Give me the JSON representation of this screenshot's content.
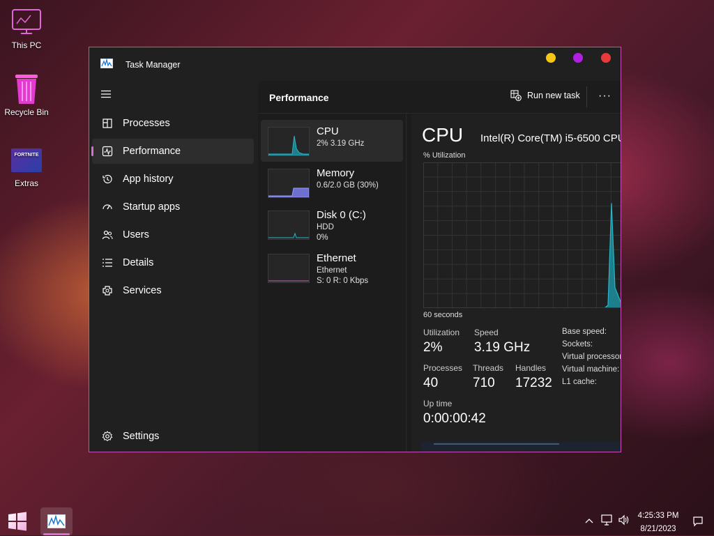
{
  "desktop": {
    "icons": [
      {
        "label": "This PC"
      },
      {
        "label": "Recycle Bin"
      },
      {
        "label": "Extras",
        "tile_text": "FORTNITE"
      }
    ]
  },
  "window": {
    "title": "Task Manager",
    "controls": {
      "minimize_color": "#f5c518",
      "maximize_color": "#b31fe0",
      "close_color": "#e83a3a"
    }
  },
  "nav": {
    "items": [
      {
        "label": "Processes",
        "icon": "processes-icon"
      },
      {
        "label": "Performance",
        "icon": "performance-icon",
        "active": true
      },
      {
        "label": "App history",
        "icon": "history-icon"
      },
      {
        "label": "Startup apps",
        "icon": "startup-icon"
      },
      {
        "label": "Users",
        "icon": "users-icon"
      },
      {
        "label": "Details",
        "icon": "details-icon"
      },
      {
        "label": "Services",
        "icon": "services-icon"
      }
    ],
    "settings_label": "Settings"
  },
  "header": {
    "title": "Performance",
    "run_task_label": "Run new task",
    "more_label": "···"
  },
  "resources": [
    {
      "name": "CPU",
      "line1": "2%  3.19 GHz",
      "line2": ""
    },
    {
      "name": "Memory",
      "line1": "0.6/2.0 GB (30%)",
      "line2": ""
    },
    {
      "name": "Disk 0 (C:)",
      "line1": "HDD",
      "line2": "0%"
    },
    {
      "name": "Ethernet",
      "line1": "Ethernet",
      "line2": "S: 0 R: 0 Kbps"
    }
  ],
  "cpu": {
    "heading": "CPU",
    "model": "Intel(R) Core(TM) i5-6500 CPU",
    "util_label": "% Utilization",
    "time_label": "60 seconds",
    "utilization_label": "Utilization",
    "utilization": "2%",
    "speed_label": "Speed",
    "speed": "3.19 GHz",
    "processes_label": "Processes",
    "processes": "40",
    "threads_label": "Threads",
    "threads": "710",
    "handles_label": "Handles",
    "handles": "17232",
    "uptime_label": "Up time",
    "uptime": "0:00:00:42",
    "specs": [
      "Base speed:",
      "Sockets:",
      "Virtual processors:",
      "Virtual machine:",
      "L1 cache:"
    ],
    "graph_series": [
      0,
      0,
      0,
      0,
      0,
      0,
      0,
      0,
      0,
      0,
      0,
      0,
      0,
      0,
      0,
      0,
      0,
      0,
      0,
      0,
      0,
      0,
      0,
      0,
      0,
      0,
      0,
      0,
      0,
      0,
      0,
      0,
      0,
      0,
      0,
      0,
      0,
      0,
      0,
      0,
      0,
      0,
      0,
      0,
      0,
      0,
      0,
      0,
      0,
      0,
      0,
      0,
      0,
      2,
      72,
      14,
      8,
      2,
      2
    ]
  },
  "taskbar": {
    "time": "4:25:33 PM",
    "date": "8/21/2023"
  },
  "colors": {
    "accent": "#d36fce",
    "graph_line": "#29b6c8",
    "graph_fill": "#1e7f8c"
  }
}
